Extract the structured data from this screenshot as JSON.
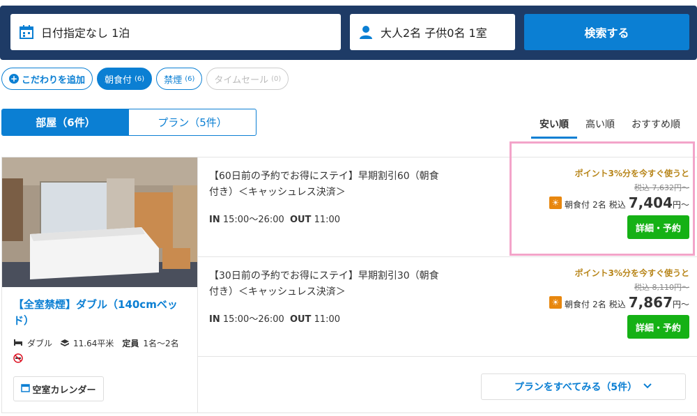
{
  "search": {
    "date_value": "日付指定なし 1泊",
    "guests_value": "大人2名 子供0名 1室",
    "search_button": "検索する"
  },
  "filters": {
    "add_label": "こだわりを追加",
    "chips": [
      {
        "label": "朝食付",
        "count": "(6)"
      },
      {
        "label": "禁煙",
        "count": "(6)"
      },
      {
        "label": "タイムセール",
        "count": "(0)"
      }
    ]
  },
  "tabs": {
    "rooms": "部屋（6件）",
    "plans": "プラン（5件）"
  },
  "sort": {
    "cheap": "安い順",
    "expensive": "高い順",
    "recommended": "おすすめ順"
  },
  "room": {
    "title": "【全室禁煙】ダブル（140cmベッド）",
    "bed_type": "ダブル",
    "area": "11.64平米",
    "capacity_label": "定員",
    "capacity": "1名〜2名",
    "calendar_button": "空室カレンダー"
  },
  "plans": [
    {
      "name": "【60日前の予約でお得にステイ】早期割引60（朝食付き）＜キャッシュレス決済＞",
      "in_label": "IN",
      "in_time": "15:00〜26:00",
      "out_label": "OUT",
      "out_time": "11:00",
      "point": "ポイント3%分を今すぐ使うと",
      "old_price": "税込 7,632円〜",
      "meal": "朝食付",
      "guests": "2名",
      "tax": "税込",
      "price": "7,404",
      "unit": "円〜",
      "book_button": "詳細・予約"
    },
    {
      "name": "【30日前の予約でお得にステイ】早期割引30（朝食付き）＜キャッシュレス決済＞",
      "in_label": "IN",
      "in_time": "15:00〜26:00",
      "out_label": "OUT",
      "out_time": "11:00",
      "point": "ポイント3%分を今すぐ使うと",
      "old_price": "税込 8,110円〜",
      "meal": "朝食付",
      "guests": "2名",
      "tax": "税込",
      "price": "7,867",
      "unit": "円〜",
      "book_button": "詳細・予約"
    }
  ],
  "see_all": "プランをすべてみる（5件）",
  "colors": {
    "header_bg": "#1e3b66",
    "accent": "#0b7fd3",
    "book_green": "#15b115",
    "point_gold": "#b8861b",
    "highlight_pink": "#f3a4c9"
  }
}
